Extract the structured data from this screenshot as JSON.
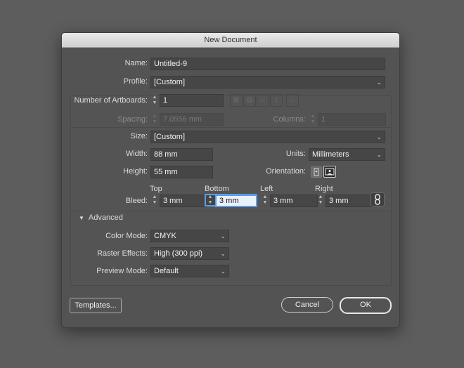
{
  "dialog": {
    "title": "New Document"
  },
  "name": {
    "label": "Name:",
    "value": "Untitled-9"
  },
  "profile": {
    "label": "Profile:",
    "value": "[Custom]"
  },
  "artboards": {
    "label": "Number of Artboards:",
    "value": "1"
  },
  "spacing": {
    "label": "Spacing:",
    "value": "7.0556 mm"
  },
  "columns": {
    "label": "Columns:",
    "value": "1"
  },
  "size": {
    "label": "Size:",
    "value": "[Custom]"
  },
  "width": {
    "label": "Width:",
    "value": "88 mm"
  },
  "units": {
    "label": "Units:",
    "value": "Millimeters"
  },
  "height": {
    "label": "Height:",
    "value": "55 mm"
  },
  "orientation": {
    "label": "Orientation:"
  },
  "bleed": {
    "label": "Bleed:",
    "top_label": "Top",
    "top_value": "3 mm",
    "bottom_label": "Bottom",
    "bottom_value": "3 mm",
    "left_label": "Left",
    "left_value": "3 mm",
    "right_label": "Right",
    "right_value": "3 mm"
  },
  "advanced": {
    "label": "Advanced",
    "color_mode_label": "Color Mode:",
    "color_mode_value": "CMYK",
    "raster_label": "Raster Effects:",
    "raster_value": "High (300 ppi)",
    "preview_label": "Preview Mode:",
    "preview_value": "Default"
  },
  "buttons": {
    "templates": "Templates...",
    "cancel": "Cancel",
    "ok": "OK"
  },
  "colors": {
    "focus": "#5a9dea",
    "dialog_bg": "#535353"
  }
}
